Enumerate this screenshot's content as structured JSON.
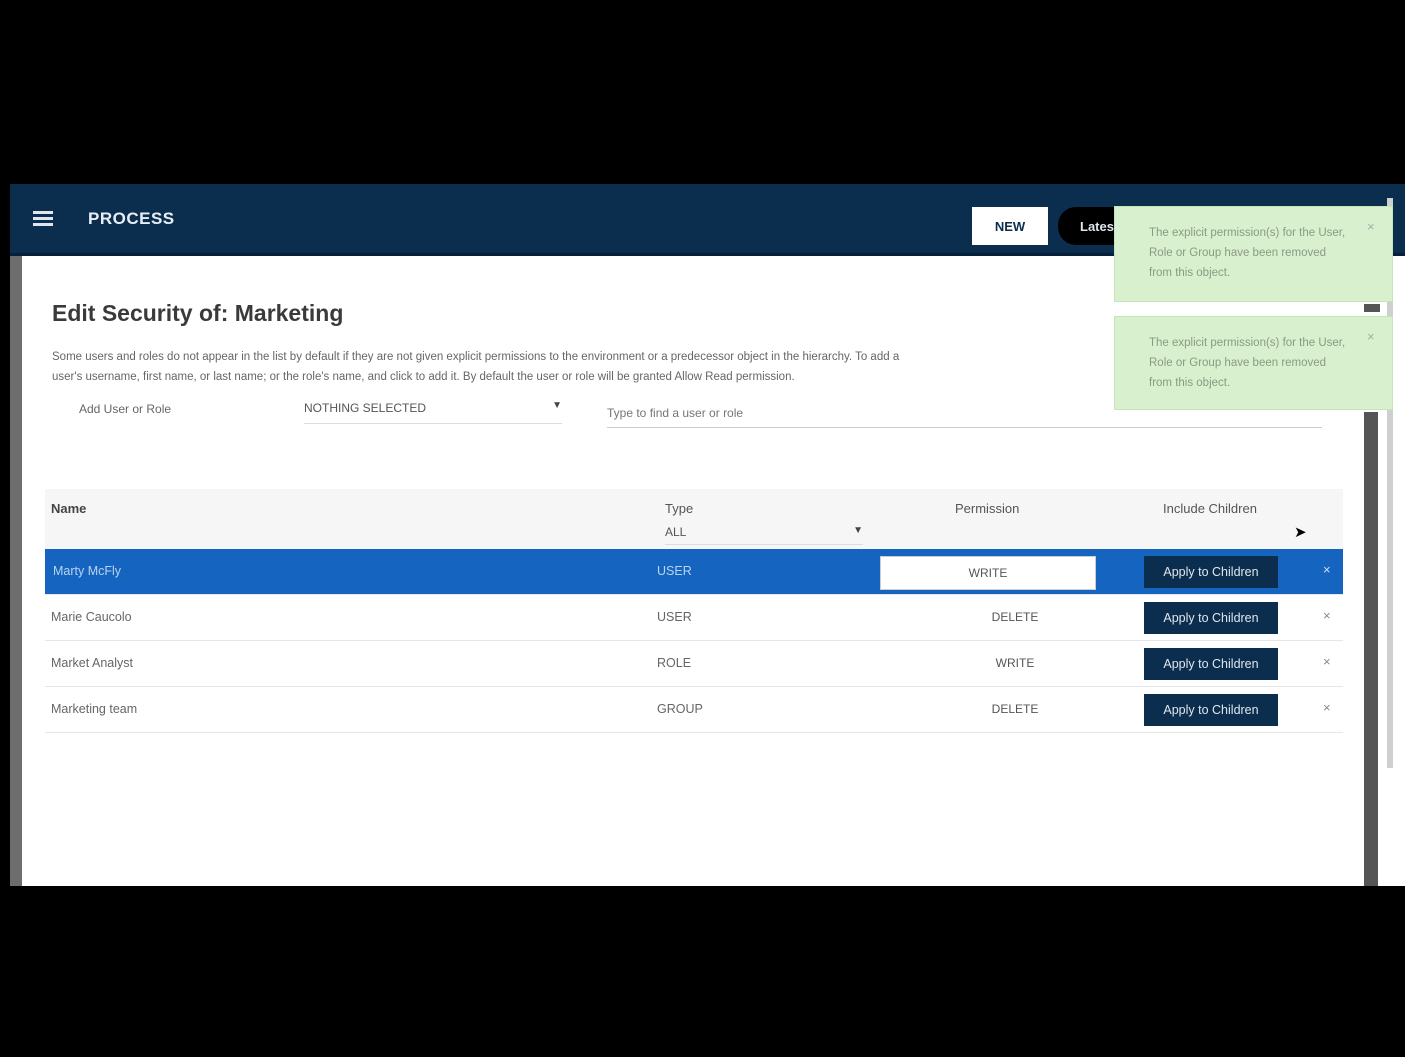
{
  "header": {
    "app_title": "PROCESS",
    "new_button": "NEW",
    "latest_button": "Latest"
  },
  "page": {
    "title": "Edit Security of: Marketing",
    "description_line1": "Some users and roles do not appear in the list by default if they are not given explicit permissions to the environment or a predecessor object in the hierarchy. To add a",
    "description_line2": "user's username, first name, or last name; or the role's name, and click to add it. By default the user or role will be granted Allow Read permission."
  },
  "add_user": {
    "label": "Add User or Role",
    "selected": "NOTHING SELECTED",
    "placeholder": "Type to find a user or role"
  },
  "table": {
    "columns": {
      "name": "Name",
      "type": "Type",
      "permission": "Permission",
      "include_children": "Include Children"
    },
    "type_filter": "ALL",
    "apply_label": "Apply to Children",
    "rows": [
      {
        "name": "Marty McFly",
        "type": "USER",
        "permission": "WRITE"
      },
      {
        "name": "Marie Caucolo",
        "type": "USER",
        "permission": "DELETE"
      },
      {
        "name": "Market Analyst",
        "type": "ROLE",
        "permission": "WRITE"
      },
      {
        "name": "Marketing team",
        "type": "GROUP",
        "permission": "DELETE"
      }
    ]
  },
  "toasts": [
    {
      "message": "The explicit permission(s) for the User, Role or Group have been removed from this object."
    },
    {
      "message": "The explicit permission(s) for the User, Role or Group have been removed from this object."
    }
  ]
}
